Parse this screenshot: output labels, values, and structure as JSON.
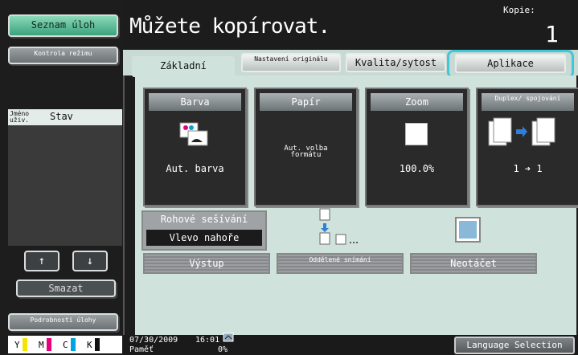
{
  "left": {
    "job_list_button": "Seznam úloh",
    "check_mode_button": "Kontrola režimu",
    "list_header": {
      "name_col": "Jméno uživ.",
      "status_col": "Stav"
    },
    "up_arrow": "↑",
    "down_arrow": "↓",
    "delete_button": "Smazat",
    "job_details_button": "Podrobnosti úlohy",
    "toner": [
      {
        "letter": "Y",
        "color": "#f5e400"
      },
      {
        "letter": "M",
        "color": "#e6007e"
      },
      {
        "letter": "C",
        "color": "#00a3e0"
      },
      {
        "letter": "K",
        "color": "#111111"
      }
    ]
  },
  "header": {
    "message": "Můžete kopírovat.",
    "copies_label": "Kopie:",
    "copies_value": "1"
  },
  "tabs": [
    {
      "label": "Základní"
    },
    {
      "label": "Nastavení originálu"
    },
    {
      "label": "Kvalita/sytost"
    },
    {
      "label": "Aplikace"
    }
  ],
  "cards": [
    {
      "title": "Barva",
      "value": "Aut. barva"
    },
    {
      "title": "Papír",
      "value": "Aut. volba formátu"
    },
    {
      "title": "Zoom",
      "value": "100.0%"
    },
    {
      "title": "Duplex/ spojování",
      "value": "1 ➔ 1"
    }
  ],
  "staple": {
    "title": "Rohové sešívání",
    "value": "Vlevo nahoře"
  },
  "actions": {
    "output": "Výstup",
    "separate_scan": "Oddělené snímání",
    "no_rotate": "Neotáčet"
  },
  "status": {
    "date": "07/30/2009",
    "time": "16:01",
    "memory_label": "Paměť",
    "memory_value": "0%",
    "language_button": "Language Selection"
  },
  "colors": {
    "accent_teal": "#3ec8d8",
    "content_bg": "#cfe3dc",
    "green_button": "#3aa27c"
  }
}
